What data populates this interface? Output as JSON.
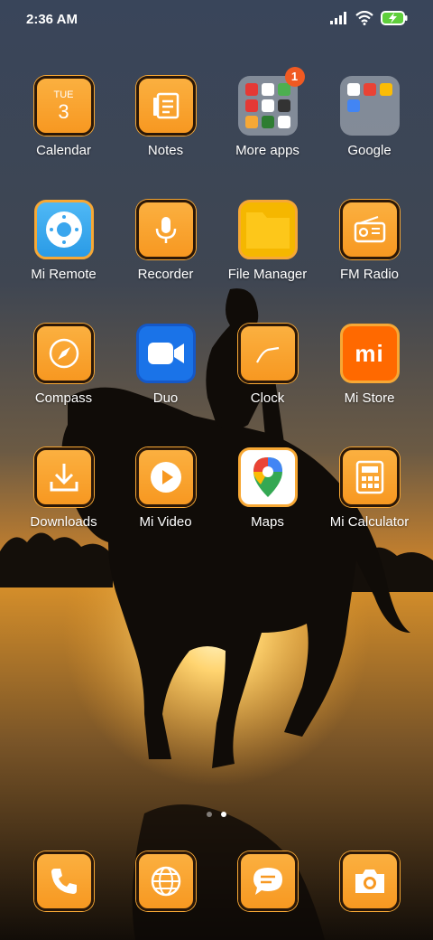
{
  "status_bar": {
    "time": "2:36 AM"
  },
  "apps_row1": [
    {
      "label": "Calendar",
      "icon": "calendar-icon",
      "cal_day": "TUE",
      "cal_date": "3"
    },
    {
      "label": "Notes",
      "icon": "notes-icon"
    },
    {
      "label": "More apps",
      "icon": "folder-icon",
      "badge": "1"
    },
    {
      "label": "Google",
      "icon": "folder-icon"
    }
  ],
  "apps_row2": [
    {
      "label": "Mi Remote",
      "icon": "remote-icon"
    },
    {
      "label": "Recorder",
      "icon": "microphone-icon"
    },
    {
      "label": "File Manager",
      "icon": "folder-file-icon"
    },
    {
      "label": "FM Radio",
      "icon": "radio-icon"
    }
  ],
  "apps_row3": [
    {
      "label": "Compass",
      "icon": "compass-icon"
    },
    {
      "label": "Duo",
      "icon": "video-camera-icon"
    },
    {
      "label": "Clock",
      "icon": "clock-icon"
    },
    {
      "label": "Mi Store",
      "icon": "mi-logo-icon",
      "logo_text": "mi"
    }
  ],
  "apps_row4": [
    {
      "label": "Downloads",
      "icon": "download-icon"
    },
    {
      "label": "Mi Video",
      "icon": "play-icon"
    },
    {
      "label": "Maps",
      "icon": "map-pin-icon"
    },
    {
      "label": "Mi Calculator",
      "icon": "calculator-icon"
    }
  ],
  "dock": [
    {
      "name": "phone",
      "icon": "phone-icon"
    },
    {
      "name": "browser",
      "icon": "globe-icon"
    },
    {
      "name": "messages",
      "icon": "message-icon"
    },
    {
      "name": "camera",
      "icon": "camera-icon"
    }
  ],
  "pager": {
    "pages": 2,
    "active": 2
  },
  "colors": {
    "icon_orange": "#fbb040",
    "badge": "#f05a22",
    "duo_blue": "#1a73e8",
    "mi_orange": "#ff6900"
  }
}
